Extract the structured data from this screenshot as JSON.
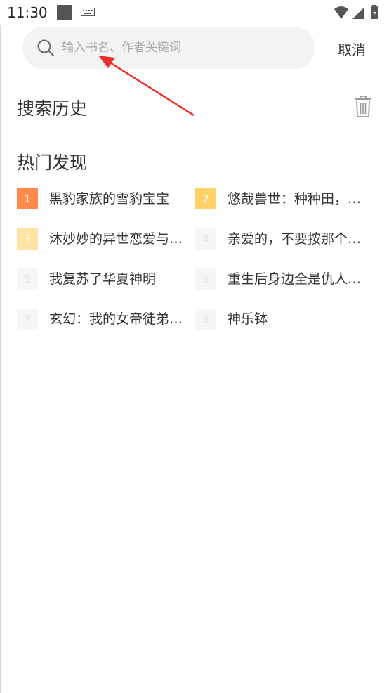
{
  "status_bar": {
    "time": "11:30",
    "icons": [
      "app-square-icon",
      "keyboard-icon",
      "wifi-icon",
      "signal-icon",
      "battery-icon"
    ]
  },
  "search": {
    "placeholder": "输入书名、作者关键词",
    "value": "",
    "cancel_label": "取消"
  },
  "history": {
    "title": "搜索历史",
    "clear_icon": "trash-icon"
  },
  "hot": {
    "title": "热门发现",
    "items": [
      {
        "rank": "1",
        "name": "黑豹家族的雪豹宝宝",
        "badge_color": "#ff8a4c"
      },
      {
        "rank": "2",
        "name": "悠哉兽世：种种田，生生崽",
        "badge_color": "#ffd166"
      },
      {
        "rank": "3",
        "name": "沐妙妙的异世恋爱与修仙",
        "badge_color": "#ffe3a3"
      },
      {
        "rank": "4",
        "name": "亲爱的，不要按那个按钮",
        "badge_color": "#f6f6f6"
      },
      {
        "rank": "5",
        "name": "我复苏了华夏神明",
        "badge_color": "#f6f6f6"
      },
      {
        "rank": "6",
        "name": "重生后身边全是仇人的儿子",
        "badge_color": "#f6f6f6"
      },
      {
        "rank": "7",
        "name": "玄幻：我的女帝徒弟们太强了",
        "badge_color": "#f6f6f6"
      },
      {
        "rank": "8",
        "name": "神乐钵",
        "badge_color": "#f6f6f6"
      }
    ]
  },
  "colors": {
    "annotation_arrow": "#e8302a",
    "search_background": "#f3f3f3",
    "placeholder_text": "#aaaaaa"
  }
}
